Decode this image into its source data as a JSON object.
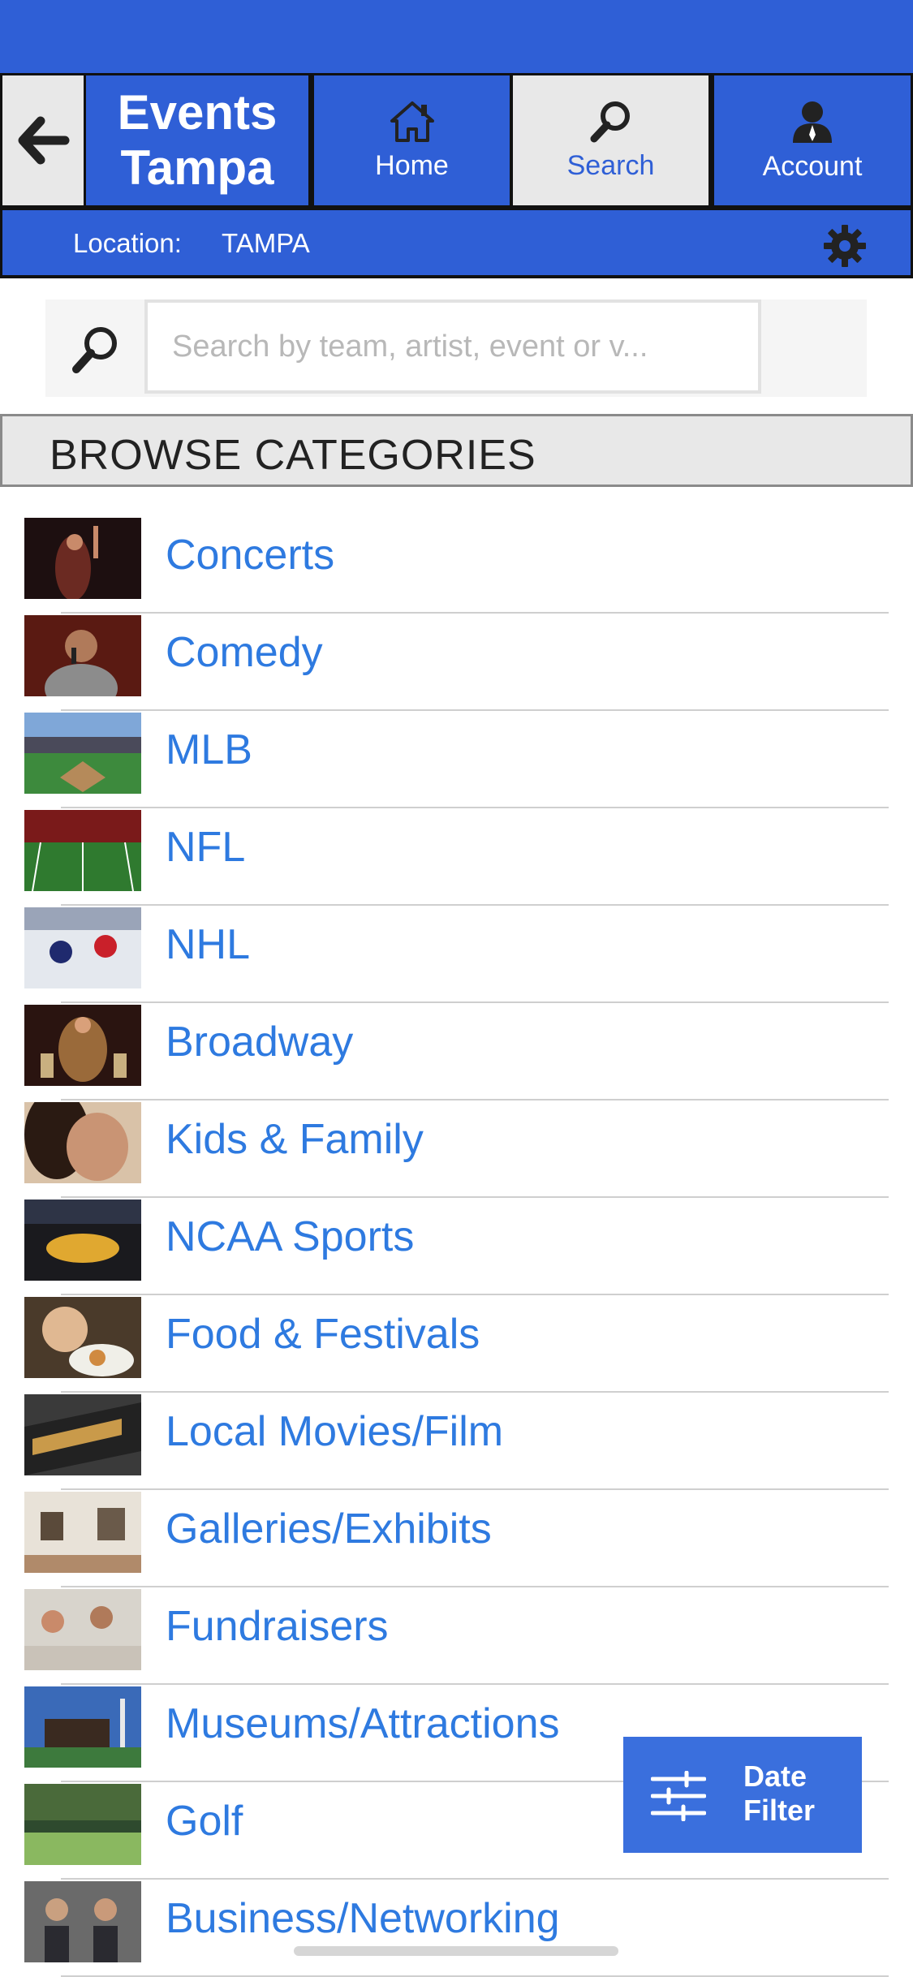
{
  "brand": {
    "line1": "Events",
    "line2": "Tampa"
  },
  "nav": {
    "home_label": "Home",
    "search_label": "Search",
    "account_label": "Account"
  },
  "location": {
    "label": "Location:",
    "value": "TAMPA"
  },
  "search": {
    "placeholder": "Search by team, artist, event or v...",
    "value": ""
  },
  "section": {
    "title": "BROWSE CATEGORIES"
  },
  "categories": [
    {
      "label": "Concerts"
    },
    {
      "label": "Comedy"
    },
    {
      "label": "MLB"
    },
    {
      "label": "NFL"
    },
    {
      "label": "NHL"
    },
    {
      "label": "Broadway"
    },
    {
      "label": "Kids & Family"
    },
    {
      "label": "NCAA Sports"
    },
    {
      "label": "Food & Festivals"
    },
    {
      "label": "Local Movies/Film"
    },
    {
      "label": "Galleries/Exhibits"
    },
    {
      "label": "Fundraisers"
    },
    {
      "label": "Museums/Attractions"
    },
    {
      "label": "Golf"
    },
    {
      "label": "Business/Networking"
    }
  ],
  "date_filter": {
    "line1": "Date",
    "line2": "Filter"
  },
  "icons": {
    "back": "arrow-left-icon",
    "home": "house-icon",
    "search": "magnifier-icon",
    "account": "person-icon",
    "settings": "gear-icon",
    "filter": "sliders-icon"
  },
  "colors": {
    "primary": "#2f5fd6",
    "link": "#2e7ae0",
    "nav_active": "#e8e8e8"
  }
}
